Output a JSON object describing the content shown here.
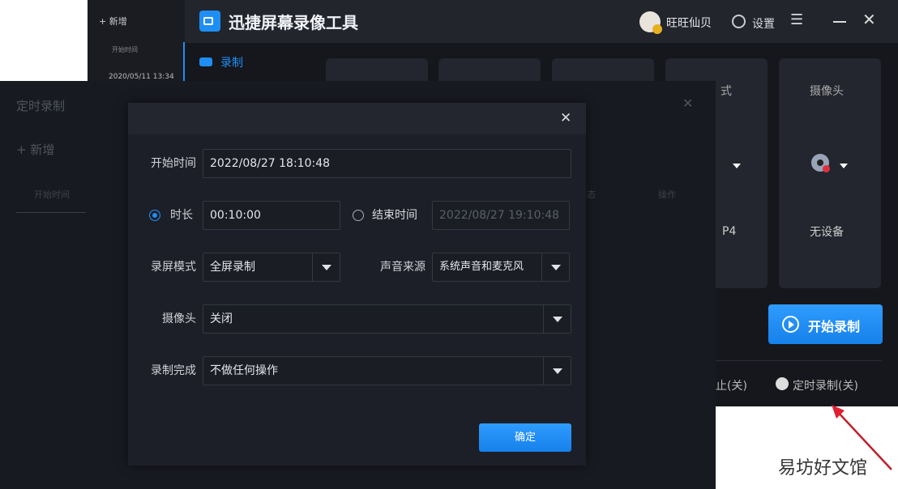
{
  "app": {
    "title": "迅捷屏幕录像工具",
    "user": "旺旺仙贝",
    "settings": "设置",
    "tab_record": "录制",
    "sidebar": {
      "add": "+ 新增",
      "col_start": "开始时间",
      "row_time": "2020/05/11 13:34"
    },
    "card4_title": "式",
    "card4_value": "P4",
    "card5_title": "摄像头",
    "card5_value": "无设备",
    "start_button": "开始录制",
    "auto_stop": "止(关)",
    "scheduled": "定时录制(关)",
    "accent": "#1e8ef5"
  },
  "outer_dialog": {
    "title": "定时录制",
    "add": "+ 新增",
    "tab": "开始时间",
    "col_a": "态",
    "col_b": "操作"
  },
  "dialog": {
    "start_label": "开始时间",
    "start_value": "2022/08/27 18:10:48",
    "duration_label": "时长",
    "duration_value": "00:10:00",
    "end_label": "结束时间",
    "end_value": "2022/08/27 19:10:48",
    "mode_label": "录屏模式",
    "mode_value": "全屏录制",
    "audio_label": "声音来源",
    "audio_value": "系统声音和麦克风",
    "camera_label": "摄像头",
    "camera_value": "关闭",
    "finish_label": "录制完成",
    "finish_value": "不做任何操作",
    "confirm": "确定",
    "selected": "duration"
  },
  "watermark": "易坊好文馆"
}
